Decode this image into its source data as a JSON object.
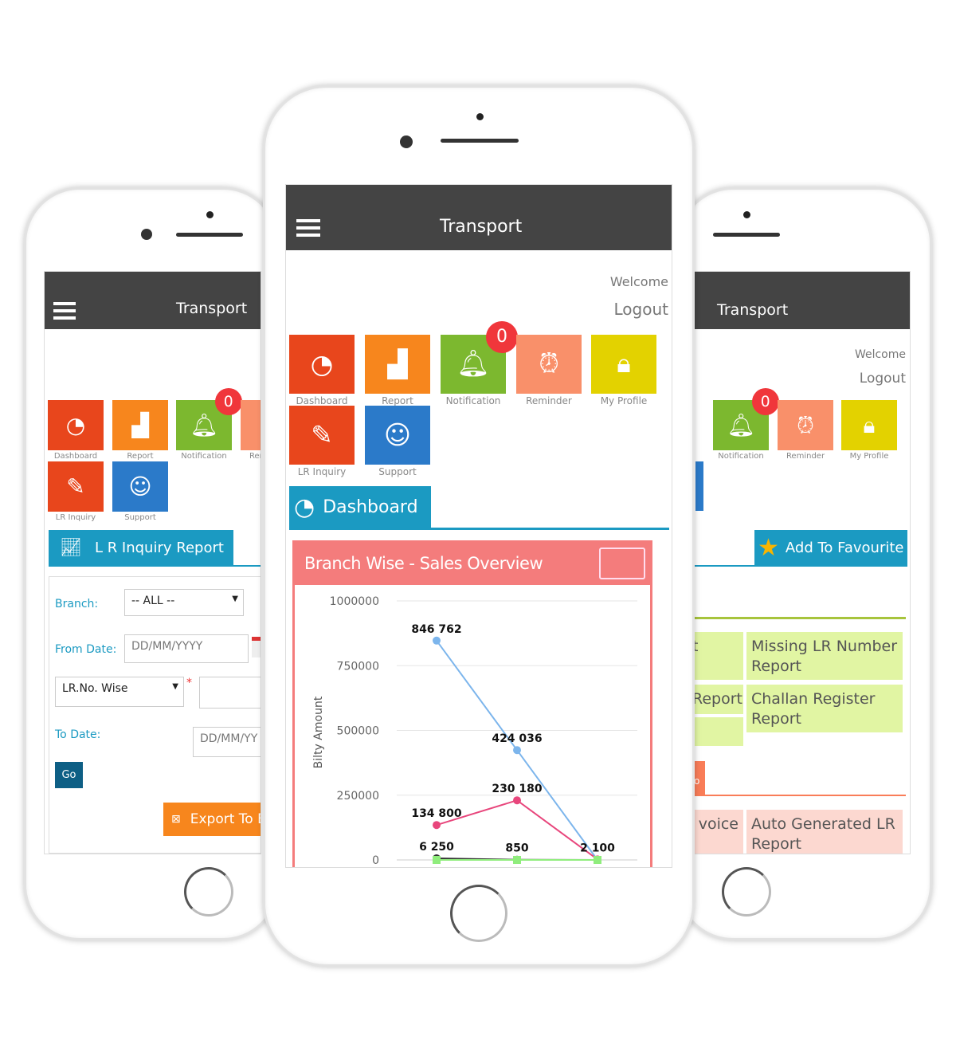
{
  "app_title": "Transport",
  "welcome": "Welcome",
  "logout": "Logout",
  "notification_count": "0",
  "tiles": [
    {
      "label": "Dashboard",
      "icon": "speedometer-icon",
      "color": "#e8461c"
    },
    {
      "label": "Report",
      "icon": "bar-chart-icon",
      "color": "#f7861d"
    },
    {
      "label": "Notification",
      "icon": "bell-icon",
      "color": "#7cb82f"
    },
    {
      "label": "Reminder",
      "icon": "alarm-clock-icon",
      "color": "#f9906a"
    },
    {
      "label": "My Profile",
      "icon": "lock-icon",
      "color": "#e3d200"
    },
    {
      "label": "LR Inquiry",
      "icon": "edit-form-icon",
      "color": "#e8461c"
    },
    {
      "label": "Support",
      "icon": "headset-icon",
      "color": "#2b7ac9"
    }
  ],
  "left": {
    "section_title": "L R Inquiry Report",
    "branch_label": "Branch:",
    "branch_value": "-- ALL --",
    "from_label": "From Date:",
    "from_placeholder": "DD/MM/YYYY",
    "mode_value": "LR.No. Wise",
    "required_mark": "*",
    "to_label": "To Date:",
    "to_placeholder": "DD/MM/YY",
    "go": "Go",
    "export": "Export To E"
  },
  "center": {
    "section_title": "Dashboard",
    "panel_title": "Branch Wise - Sales Overview",
    "accent": "#f47c7c"
  },
  "right": {
    "favourite": "Add To Favourite",
    "green_rows": [
      [
        "t",
        "Missing LR Number Report"
      ],
      [
        "Report",
        "Challan Register Report"
      ],
      [
        "t",
        ""
      ]
    ],
    "orange_tab": "o",
    "pink_rows": [
      [
        "voice",
        "Auto Generated LR Report"
      ]
    ]
  },
  "chart_data": {
    "type": "line",
    "title": "Branch Wise - Sales Overview",
    "ylabel": "Bilty Amount",
    "ylim": [
      0,
      1000000
    ],
    "yticks": [
      "1000000",
      "750000",
      "500000",
      "250000",
      "0"
    ],
    "grid": true,
    "x": [
      1,
      2,
      3
    ],
    "series": [
      {
        "color": "#7cb5ec",
        "values": [
          846762,
          424036,
          0
        ],
        "labels": [
          "846 762",
          "424 036",
          ""
        ]
      },
      {
        "color": "#e8467c",
        "values": [
          134800,
          230180,
          2100
        ],
        "labels": [
          "134 800",
          "230 180",
          "2 100"
        ]
      },
      {
        "color": "#333333",
        "values": [
          6250,
          850,
          0
        ],
        "labels": [
          "6 250",
          "850",
          ""
        ]
      },
      {
        "color": "#90ed7d",
        "values": [
          0,
          0,
          0
        ],
        "labels": [
          "",
          "",
          ""
        ]
      }
    ]
  }
}
